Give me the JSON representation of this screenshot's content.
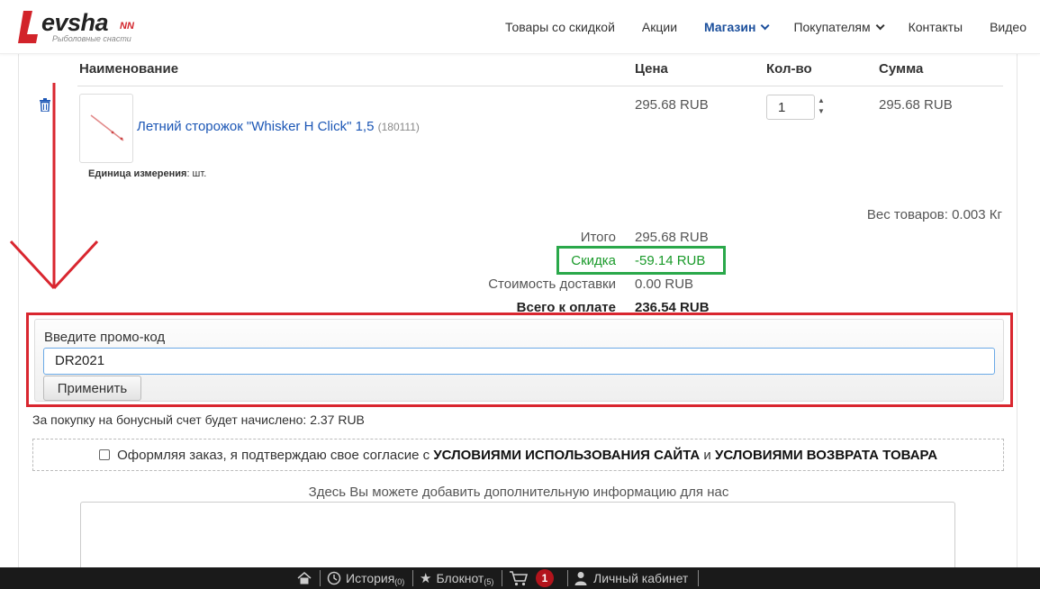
{
  "header": {
    "logo": {
      "text": "evsha",
      "suffix": "NN",
      "tagline": "Рыболовные снасти"
    },
    "nav": [
      {
        "label": "Товары со скидкой",
        "active": false,
        "dropdown": false
      },
      {
        "label": "Акции",
        "active": false,
        "dropdown": false
      },
      {
        "label": "Магазин",
        "active": true,
        "dropdown": true
      },
      {
        "label": "Покупателям",
        "active": false,
        "dropdown": true
      },
      {
        "label": "Контакты",
        "active": false,
        "dropdown": false
      },
      {
        "label": "Видео",
        "active": false,
        "dropdown": false
      }
    ]
  },
  "cart": {
    "columns": {
      "name": "Наименование",
      "price": "Цена",
      "qty": "Кол-во",
      "sum": "Сумма"
    },
    "items": [
      {
        "title": "Летний сторожок \"Whisker H Click\" 1,5",
        "code": "(180111)",
        "unit_label": "Единица измерения",
        "unit_value": ": шт.",
        "price": "295.68 RUB",
        "qty": "1",
        "sum": "295.68 RUB"
      }
    ],
    "weight": "Вес товаров: 0.003 Кг",
    "totals": {
      "subtotal_label": "Итого",
      "subtotal_value": "295.68 RUB",
      "discount_label": "Скидка",
      "discount_value": "-59.14 RUB",
      "delivery_label": "Стоимость доставки",
      "delivery_value": "0.00 RUB",
      "grand_label": "Всего к оплате",
      "grand_value": "236.54 RUB"
    }
  },
  "promo": {
    "label": "Введите промо-код",
    "value": "DR2021",
    "apply_label": "Применить"
  },
  "bonus_text": "За покупку на бонусный счет будет начислено: 2.37 RUB",
  "agreement": {
    "prefix": "Оформляя заказ, я подтверждаю свое согласие с",
    "terms": "УСЛОВИЯМИ ИСПОЛЬЗОВАНИЯ САЙТА",
    "and": "и",
    "returns": "УСЛОВИЯМИ ВОЗВРАТА ТОВАРА"
  },
  "comment": {
    "label": "Здесь Вы можете добавить дополнительную информацию для нас"
  },
  "bottom_bar": {
    "history_label": "История",
    "history_count": "(0)",
    "notepad_label": "Блокнот",
    "notepad_count": "(5)",
    "cart_count": "1",
    "account_label": "Личный кабинет"
  },
  "colors": {
    "accent_red": "#d9262f",
    "discount_green": "#2aa84a",
    "link_blue": "#1b56b5",
    "nav_active": "#1b4f9c"
  }
}
